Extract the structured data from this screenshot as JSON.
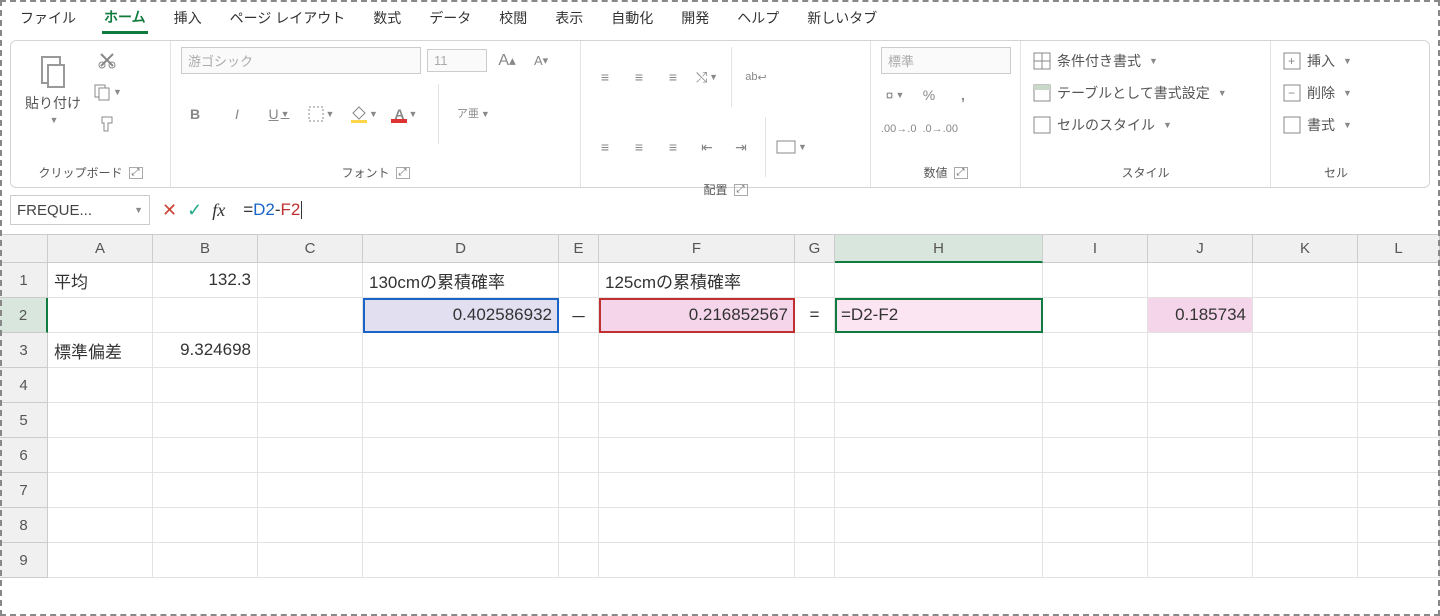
{
  "menu": {
    "file": "ファイル",
    "home": "ホーム",
    "insert": "挿入",
    "pagelayout": "ページ レイアウト",
    "formulas": "数式",
    "data": "データ",
    "review": "校閲",
    "view": "表示",
    "automate": "自動化",
    "developer": "開発",
    "help": "ヘルプ",
    "newtab": "新しいタブ"
  },
  "ribbon": {
    "clipboard_label": "クリップボード",
    "paste": "貼り付け",
    "font_label": "フォント",
    "font_name": "游ゴシック",
    "font_size": "11",
    "ruby": "ア亜",
    "align_label": "配置",
    "wrap": "ab",
    "number_label": "数値",
    "format": "標準",
    "styles_label": "スタイル",
    "cond": "条件付き書式",
    "table": "テーブルとして書式設定",
    "cellstyle": "セルのスタイル",
    "cells_label": "セル",
    "ins": "挿入",
    "del": "削除",
    "fmt": "書式"
  },
  "fbar": {
    "name": "FREQUE...",
    "formula_eq": "=",
    "formula_r1": "D2",
    "formula_op": "-",
    "formula_r2": "F2",
    "fx": "fx"
  },
  "cols": {
    "A": "A",
    "B": "B",
    "C": "C",
    "D": "D",
    "E": "E",
    "F": "F",
    "G": "G",
    "H": "H",
    "I": "I",
    "J": "J",
    "K": "K",
    "L": "L"
  },
  "rows": {
    "r1": "1",
    "r2": "2",
    "r3": "3",
    "r4": "4",
    "r5": "5",
    "r6": "6",
    "r7": "7",
    "r8": "8",
    "r9": "9"
  },
  "cells": {
    "A1": "平均",
    "B1": "132.3",
    "D1": "130cmの累積確率",
    "F1": "125cmの累積確率",
    "D2": "0.402586932",
    "E2": "－",
    "F2": "0.216852567",
    "G2": "=",
    "H2": "=D2-F2",
    "J2": "0.185734",
    "A3": "標準偏差",
    "B3": "9.324698"
  },
  "chart_data": null
}
